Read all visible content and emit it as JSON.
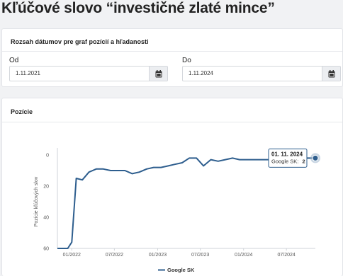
{
  "page": {
    "title": "Kľúčové slovo “investičné zlaté mince”"
  },
  "date_range": {
    "header": "Rozsah dátumov pre graf pozícií a hľadanosti",
    "from_label": "Od",
    "from_value": "1.11.2021",
    "to_label": "Do",
    "to_value": "1.11.2024",
    "calendar_icon": "calendar-icon"
  },
  "positions": {
    "header": "Pozície"
  },
  "tooltip": {
    "date": "01. 11. 2024",
    "series": "Google SK:",
    "value": "2"
  },
  "colors": {
    "line": "#2e5e8e",
    "accent_dot": "#2e5e8e"
  },
  "chart_data": {
    "type": "line",
    "ylabel": "Pozície kľúčových slov",
    "xlabel": "",
    "y_reversed": true,
    "ylim": [
      0,
      60
    ],
    "y_ticks": [
      0,
      20,
      40,
      60
    ],
    "x_ticks": [
      "01/2022",
      "07/2022",
      "01/2023",
      "07/2023",
      "01/2024",
      "07/2024"
    ],
    "grid": false,
    "legend": "bottom",
    "series": [
      {
        "name": "Google SK",
        "points": [
          [
            "2021-11-01",
            60
          ],
          [
            "2021-11-15",
            60
          ],
          [
            "2021-12-01",
            60
          ],
          [
            "2021-12-15",
            60
          ],
          [
            "2022-01-01",
            56
          ],
          [
            "2022-01-20",
            15
          ],
          [
            "2022-02-15",
            16
          ],
          [
            "2022-03-15",
            11
          ],
          [
            "2022-04-15",
            9
          ],
          [
            "2022-05-15",
            9
          ],
          [
            "2022-06-15",
            10
          ],
          [
            "2022-07-15",
            10
          ],
          [
            "2022-08-15",
            10
          ],
          [
            "2022-09-15",
            12
          ],
          [
            "2022-10-15",
            11
          ],
          [
            "2022-11-15",
            9
          ],
          [
            "2022-12-15",
            8
          ],
          [
            "2023-01-15",
            8
          ],
          [
            "2023-02-15",
            7
          ],
          [
            "2023-03-15",
            6
          ],
          [
            "2023-04-15",
            5
          ],
          [
            "2023-05-15",
            2
          ],
          [
            "2023-06-15",
            2
          ],
          [
            "2023-07-15",
            7
          ],
          [
            "2023-08-15",
            3
          ],
          [
            "2023-09-15",
            4
          ],
          [
            "2023-10-15",
            3
          ],
          [
            "2023-11-15",
            2
          ],
          [
            "2023-12-15",
            3
          ],
          [
            "2024-01-15",
            3
          ],
          [
            "2024-02-15",
            3
          ],
          [
            "2024-03-15",
            3
          ],
          [
            "2024-04-15",
            3
          ],
          [
            "2024-05-15",
            2
          ],
          [
            "2024-06-15",
            2
          ],
          [
            "2024-07-15",
            2
          ],
          [
            "2024-08-15",
            2
          ],
          [
            "2024-09-15",
            2
          ],
          [
            "2024-10-15",
            2
          ],
          [
            "2024-11-01",
            2
          ]
        ]
      }
    ]
  }
}
